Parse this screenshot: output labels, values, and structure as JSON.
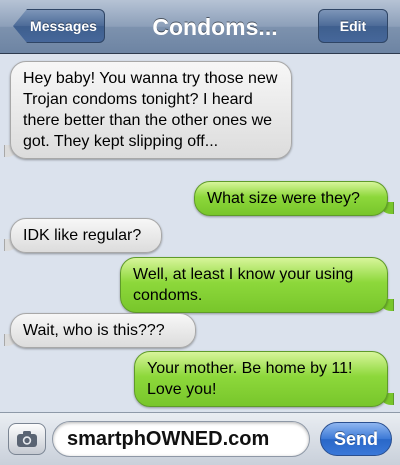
{
  "navbar": {
    "back_label": "Messages",
    "title": "Condoms...",
    "edit_label": "Edit"
  },
  "messages": [
    {
      "direction": "incoming",
      "text": "Hey baby! You wanna try those new Trojan condoms tonight? I heard there better than the other ones we got. They kept slipping off..."
    },
    {
      "direction": "outgoing",
      "text": "What size were they?"
    },
    {
      "direction": "incoming",
      "text": "IDK like regular?"
    },
    {
      "direction": "outgoing",
      "text": "Well, at least I know your using condoms."
    },
    {
      "direction": "incoming",
      "text": "Wait, who is this???"
    },
    {
      "direction": "outgoing",
      "text": "Your mother. Be home by 11! Love you!"
    }
  ],
  "composer": {
    "input_value": "smartphOWNED.com",
    "send_label": "Send",
    "camera_icon": "camera-icon"
  },
  "colors": {
    "incoming_bubble": "#e6e6e6",
    "outgoing_bubble": "#8dd83b",
    "background": "#dbe2ed",
    "send_button": "#3c79d6"
  }
}
